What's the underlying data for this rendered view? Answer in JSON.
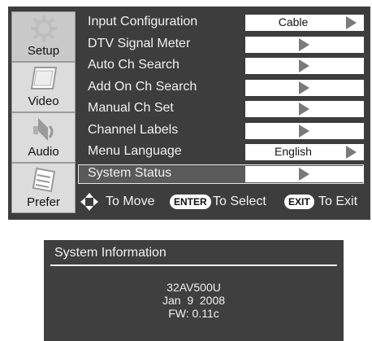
{
  "sidebar": {
    "tabs": [
      {
        "label": "Setup",
        "icon": "gear-icon",
        "active": true
      },
      {
        "label": "Video",
        "icon": "screen-icon",
        "active": false
      },
      {
        "label": "Audio",
        "icon": "speaker-icon",
        "active": false
      },
      {
        "label": "Prefer",
        "icon": "notepad-icon",
        "active": false
      }
    ]
  },
  "menu": {
    "items": [
      {
        "label": "Input Configuration",
        "value": "Cable"
      },
      {
        "label": "DTV Signal Meter",
        "value": ""
      },
      {
        "label": "Auto Ch Search",
        "value": ""
      },
      {
        "label": "Add On Ch Search",
        "value": ""
      },
      {
        "label": "Manual Ch Set",
        "value": ""
      },
      {
        "label": "Channel Labels",
        "value": ""
      },
      {
        "label": "Menu Language",
        "value": "English"
      },
      {
        "label": "System Status",
        "value": "",
        "selected": true
      }
    ]
  },
  "help": {
    "move": "To Move",
    "enter_key": "ENTER",
    "select": "To Select",
    "exit_key": "EXIT",
    "exit": "To Exit"
  },
  "info": {
    "title": "System Information",
    "model": "32AV500U",
    "date": "Jan  9  2008",
    "firmware": "FW: 0.11c"
  },
  "colors": {
    "panel": "#3d3d3d",
    "text": "#f1f1f1",
    "value_box": "#ffffff",
    "tab_bg": "#dcdcdc"
  }
}
